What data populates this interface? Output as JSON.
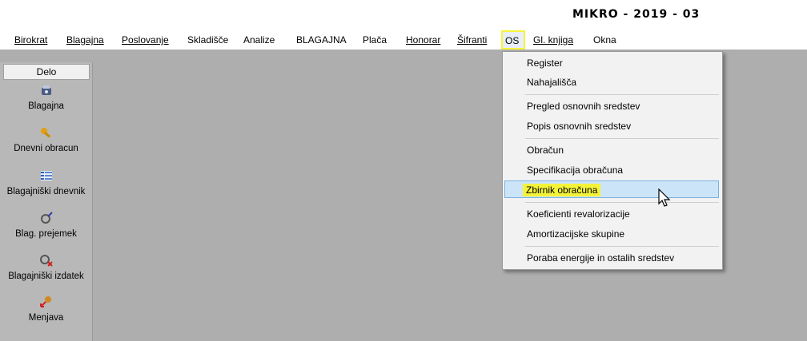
{
  "window": {
    "title": "MIKRO - 2019 - 03"
  },
  "menubar": {
    "items": [
      {
        "label": "Birokrat",
        "underlined": true
      },
      {
        "label": "Blagajna",
        "underlined": true
      },
      {
        "label": "Poslovanje",
        "underlined": true
      },
      {
        "label": "Skladišče",
        "underlined": false
      },
      {
        "label": "Analize",
        "underlined": false
      },
      {
        "label": "BLAGAJNA",
        "underlined": false
      },
      {
        "label": "Plača",
        "underlined": false
      },
      {
        "label": "Honorar",
        "underlined": true
      },
      {
        "label": "Šifranti",
        "underlined": true
      },
      {
        "label": "OS",
        "underlined": false,
        "active": true
      },
      {
        "label": "Gl. knjiga",
        "underlined": true
      },
      {
        "label": "Okna",
        "underlined": false
      }
    ]
  },
  "leftpanel": {
    "header": "Delo",
    "tools": [
      {
        "label": "Blagajna",
        "icon": "cash-register-icon"
      },
      {
        "label": "Dnevni obracun",
        "icon": "key-icon"
      },
      {
        "label": "Blagajniški dnevnik",
        "icon": "ledger-icon"
      },
      {
        "label": "Blag. prejemek",
        "icon": "receipt-in-icon"
      },
      {
        "label": "Blagajniški izdatek",
        "icon": "receipt-out-icon"
      },
      {
        "label": "Menjava",
        "icon": "exchange-icon"
      }
    ]
  },
  "dropdown": {
    "groups": [
      [
        "Register",
        "Nahajališča"
      ],
      [
        "Pregled osnovnih sredstev",
        "Popis osnovnih sredstev"
      ],
      [
        "Obračun",
        "Specifikacija obračuna",
        "Zbirnik obračuna"
      ],
      [
        "Koeficienti revalorizacije",
        "Amortizacijske skupine"
      ],
      [
        "Poraba energije in ostalih sredstev"
      ]
    ],
    "hovered": "Zbirnik obračuna"
  },
  "colors": {
    "workspace": "#aeaeae",
    "highlight": "#f3f33a",
    "hover": "#cce4f7"
  }
}
